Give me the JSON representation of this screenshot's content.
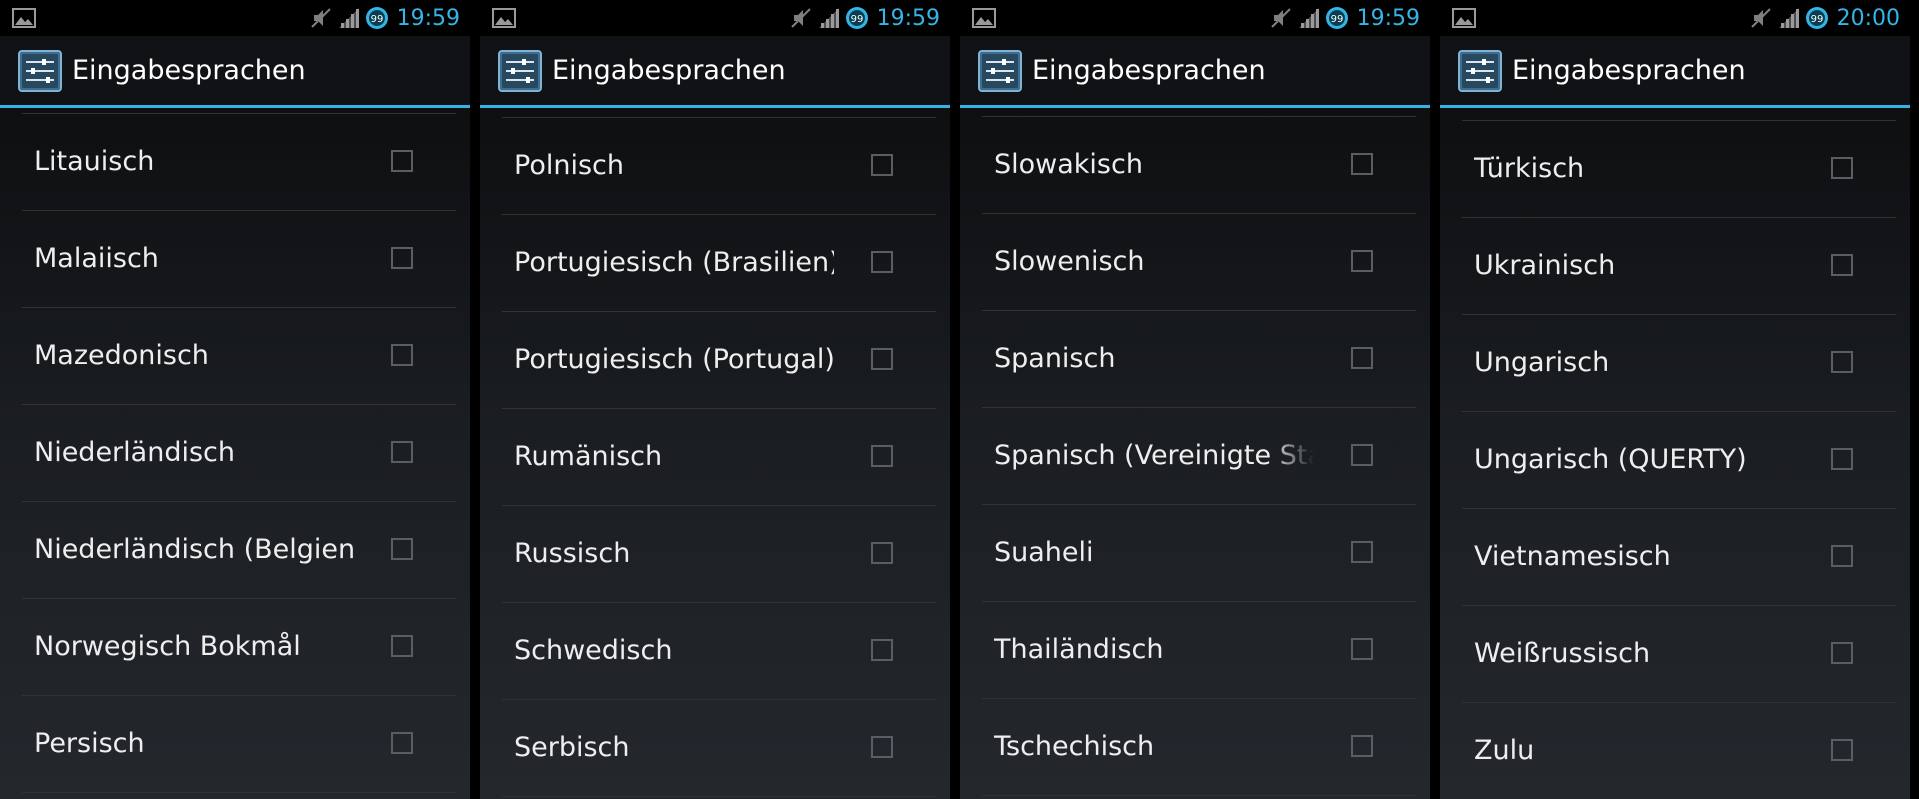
{
  "panels": [
    {
      "time": "19:59",
      "title": "Eingabesprachen",
      "items": [
        {
          "label": "Litauisch",
          "checked": false
        },
        {
          "label": "Malaiisch",
          "checked": false
        },
        {
          "label": "Mazedonisch",
          "checked": false
        },
        {
          "label": "Niederländisch",
          "checked": false
        },
        {
          "label": "Niederländisch (Belgien)",
          "checked": false
        },
        {
          "label": "Norwegisch Bokmål",
          "checked": false
        },
        {
          "label": "Persisch",
          "checked": false
        }
      ]
    },
    {
      "time": "19:59",
      "title": "Eingabesprachen",
      "items": [
        {
          "label": "Polnisch",
          "checked": false
        },
        {
          "label": "Portugiesisch (Brasilien)",
          "checked": false
        },
        {
          "label": "Portugiesisch (Portugal)",
          "checked": false
        },
        {
          "label": "Rumänisch",
          "checked": false
        },
        {
          "label": "Russisch",
          "checked": false
        },
        {
          "label": "Schwedisch",
          "checked": false
        },
        {
          "label": "Serbisch",
          "checked": false
        }
      ]
    },
    {
      "time": "19:59",
      "title": "Eingabesprachen",
      "items": [
        {
          "label": "Slowakisch",
          "checked": false
        },
        {
          "label": "Slowenisch",
          "checked": false
        },
        {
          "label": "Spanisch",
          "checked": false
        },
        {
          "label": "Spanisch (Vereinigte Staaten)",
          "checked": false
        },
        {
          "label": "Suaheli",
          "checked": false
        },
        {
          "label": "Thailändisch",
          "checked": false
        },
        {
          "label": "Tschechisch",
          "checked": false
        }
      ]
    },
    {
      "time": "20:00",
      "title": "Eingabesprachen",
      "items": [
        {
          "label": "Türkisch",
          "checked": false
        },
        {
          "label": "Ukrainisch",
          "checked": false
        },
        {
          "label": "Ungarisch",
          "checked": false
        },
        {
          "label": "Ungarisch (QUERTY)",
          "checked": false
        },
        {
          "label": "Vietnamesisch",
          "checked": false
        },
        {
          "label": "Weißrussisch",
          "checked": false
        },
        {
          "label": "Zulu",
          "checked": false
        }
      ]
    }
  ],
  "status_icons": {
    "left": "gallery-notification-icon",
    "right": [
      "mute-icon",
      "signal-icon",
      "battery-icon"
    ],
    "battery_text": "99"
  },
  "colors": {
    "accent": "#33b5e5",
    "background": "#000000",
    "text": "#eeeeee",
    "divider": "#2f3236",
    "checkbox_border": "#5a5e63"
  }
}
